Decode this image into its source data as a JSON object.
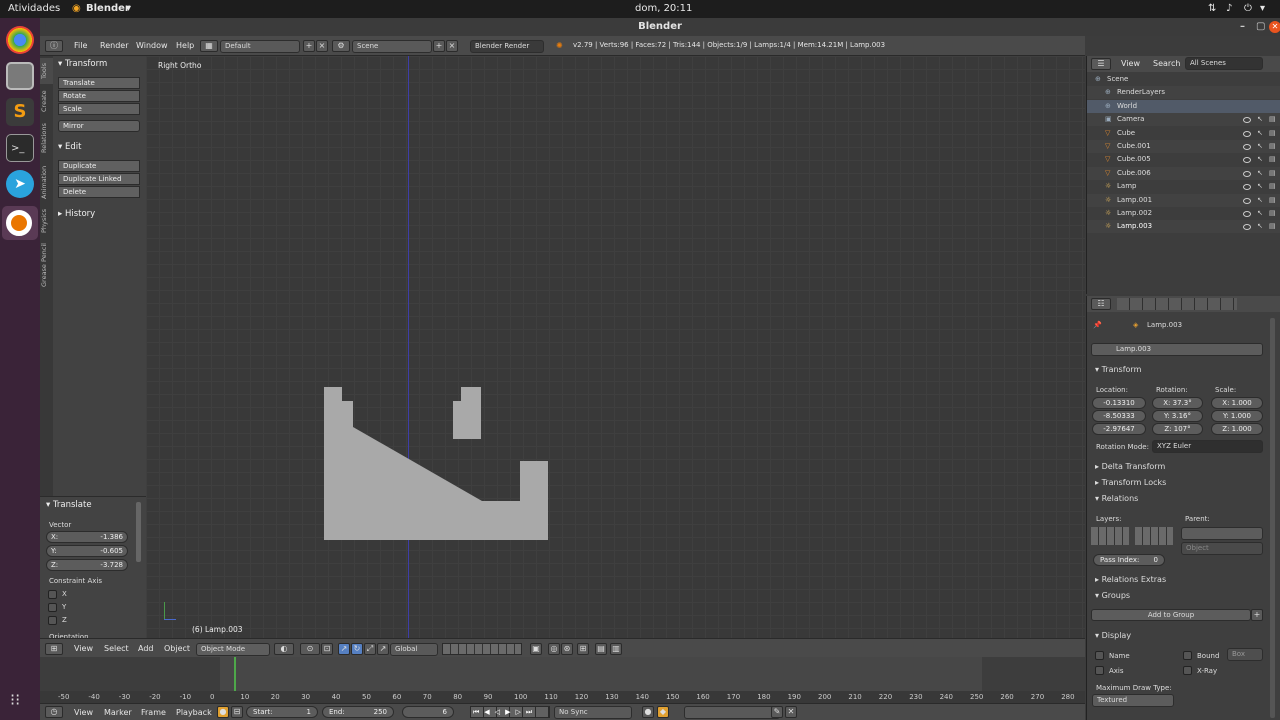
{
  "topbar": {
    "activities": "Atividades",
    "app": "Blender",
    "app_arrow": "▾",
    "clock": "dom, 20:11"
  },
  "window": {
    "title": "Blender"
  },
  "menubar": {
    "items": [
      "File",
      "Render",
      "Window",
      "Help"
    ],
    "layout": "Default",
    "scene": "Scene",
    "engine": "Blender Render",
    "stats": "v2.79 | Verts:96 | Faces:72 | Tris:144 | Objects:1/9 | Lamps:1/4 | Mem:14.21M | Lamp.003"
  },
  "toolshelf": {
    "tabs": [
      "Tools",
      "Create",
      "Relations",
      "Animation",
      "Physics",
      "Grease Pencil"
    ],
    "transform_header": "Transform",
    "transform_buttons": [
      "Translate",
      "Rotate",
      "Scale"
    ],
    "mirror": "Mirror",
    "edit_header": "Edit",
    "edit_buttons": [
      "Duplicate",
      "Duplicate Linked",
      "Delete"
    ],
    "history_header": "History"
  },
  "operator": {
    "header": "Translate",
    "vector_label": "Vector",
    "x_label": "X:",
    "x": "-1.386",
    "y_label": "Y:",
    "y": "-0.605",
    "z_label": "Z:",
    "z": "-3.728",
    "constraint_label": "Constraint Axis",
    "axes": [
      "X",
      "Y",
      "Z"
    ],
    "orientation": "Orientation"
  },
  "viewport": {
    "view_name": "Right Ortho",
    "object_label": "(6) Lamp.003"
  },
  "vpbar": {
    "menus": [
      "View",
      "Select",
      "Add",
      "Object"
    ],
    "mode": "Object Mode",
    "orientation": "Global"
  },
  "timeline": {
    "ticks": [
      "-50",
      "-40",
      "-30",
      "-20",
      "-10",
      "0",
      "10",
      "20",
      "30",
      "40",
      "50",
      "60",
      "70",
      "80",
      "90",
      "100",
      "110",
      "120",
      "130",
      "140",
      "150",
      "160",
      "170",
      "180",
      "190",
      "200",
      "210",
      "220",
      "230",
      "240",
      "250",
      "260",
      "270",
      "280"
    ],
    "current_frame": 6
  },
  "tlbar": {
    "menus": [
      "View",
      "Marker",
      "Frame",
      "Playback"
    ],
    "start": "Start:",
    "start_val": "1",
    "end": "End:",
    "end_val": "250",
    "frame": "6",
    "sync": "No Sync"
  },
  "outliner": {
    "menus": [
      "View",
      "Search"
    ],
    "filter": "All Scenes",
    "items": [
      {
        "name": "Scene",
        "indent": 0
      },
      {
        "name": "RenderLayers",
        "indent": 1
      },
      {
        "name": "World",
        "indent": 1
      },
      {
        "name": "Camera",
        "indent": 1
      },
      {
        "name": "Cube",
        "indent": 1
      },
      {
        "name": "Cube.001",
        "indent": 1
      },
      {
        "name": "Cube.005",
        "indent": 1
      },
      {
        "name": "Cube.006",
        "indent": 1
      },
      {
        "name": "Lamp",
        "indent": 1
      },
      {
        "name": "Lamp.001",
        "indent": 1
      },
      {
        "name": "Lamp.002",
        "indent": 1
      },
      {
        "name": "Lamp.003",
        "indent": 1
      }
    ]
  },
  "props": {
    "breadcrumb": "Lamp.003",
    "object_name": "Lamp.003",
    "transform_header": "Transform",
    "location_label": "Location:",
    "rotation_label": "Rotation:",
    "scale_label": "Scale:",
    "location": [
      "-0.13310",
      "-8.50333",
      "-2.97647"
    ],
    "rotation": [
      "X:  37.3°",
      "Y:  3.16°",
      "Z:  107°"
    ],
    "scale": [
      "X:  1.000",
      "Y:  1.000",
      "Z:  1.000"
    ],
    "rotation_mode_label": "Rotation Mode:",
    "rotation_mode": "XYZ Euler",
    "delta": "Delta Transform",
    "locks": "Transform Locks",
    "relations": "Relations",
    "layers_label": "Layers:",
    "parent_label": "Parent:",
    "parent_type": "Object",
    "pass_index": "Pass Index:",
    "pass_val": "0",
    "relations_extras": "Relations Extras",
    "groups": "Groups",
    "add_group": "Add to Group",
    "display": "Display",
    "name": "Name",
    "bound": "Bound",
    "bound_type": "Box",
    "axis": "Axis",
    "xray": "X-Ray",
    "max_draw": "Maximum Draw Type:",
    "max_draw_val": "Textured"
  }
}
